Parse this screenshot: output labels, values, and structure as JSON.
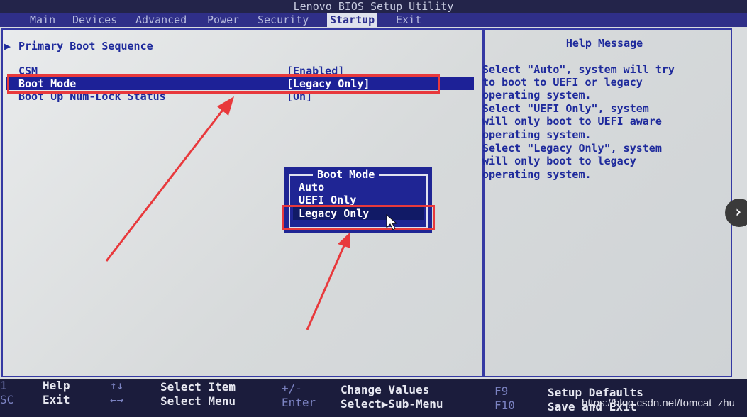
{
  "window": {
    "title": "Lenovo BIOS Setup Utility"
  },
  "tabs": [
    "Main",
    "Devices",
    "Advanced",
    "Power",
    "Security",
    "Startup",
    "Exit"
  ],
  "active_tab": "Startup",
  "left": {
    "section_arrow": "▶",
    "section_header": "Primary Boot Sequence",
    "rows": [
      {
        "label": "CSM",
        "value": "[Enabled]"
      },
      {
        "label": "Boot Mode",
        "value": "[Legacy Only]"
      },
      {
        "label": "Boot Up Num-Lock Status",
        "value": "[On]"
      }
    ]
  },
  "help": {
    "title": "Help Message",
    "lines": [
      "Select \"Auto\", system will try",
      "to boot to UEFI or legacy",
      "operating system.",
      "Select \"UEFI Only\", system",
      "will only boot to UEFI aware",
      "operating system.",
      "Select \"Legacy Only\", system",
      "will only boot to legacy",
      "operating system."
    ]
  },
  "popup": {
    "title": "Boot Mode",
    "options": [
      "Auto",
      "UEFI Only",
      "Legacy Only"
    ],
    "selected": "Legacy Only"
  },
  "keybar": [
    {
      "key": "1",
      "label": "Help"
    },
    {
      "key": "SC",
      "label": "Exit"
    },
    {
      "key": "↑↓",
      "label": "Select Item"
    },
    {
      "key": "←→",
      "label": "Select Menu"
    },
    {
      "key": "+/-",
      "label": "Change Values"
    },
    {
      "key": "Enter",
      "label": "Select▶Sub-Menu"
    },
    {
      "key": "F9",
      "label": "Setup Defaults"
    },
    {
      "key": "F10",
      "label": "Save and Exit"
    }
  ],
  "nav": {
    "next": "›"
  },
  "watermark": "https://blog.csdn.net/tomcat_zhu",
  "colors": {
    "accent": "#1f2594",
    "annotation": "#e8393c",
    "tab_bar": "#2f2f88"
  }
}
